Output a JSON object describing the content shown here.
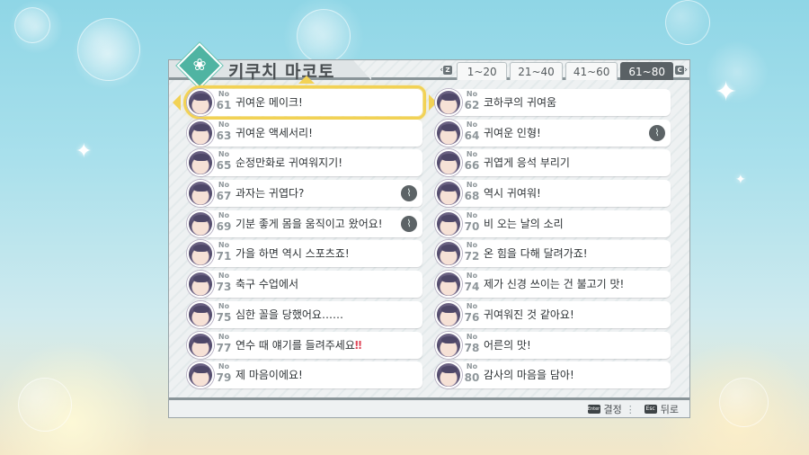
{
  "window": {
    "title": "키쿠치 마코토"
  },
  "tabs": [
    {
      "label": "1~20",
      "active": false
    },
    {
      "label": "21~40",
      "active": false
    },
    {
      "label": "41~60",
      "active": false
    },
    {
      "label": "61~80",
      "active": true
    }
  ],
  "tab_nav": {
    "prev_key": "Z",
    "next_key": "C"
  },
  "no_prefix": "No",
  "items": [
    {
      "no": "61",
      "label": "귀여운 메이크!",
      "selected": true
    },
    {
      "no": "62",
      "label": "코하쿠의 귀여움"
    },
    {
      "no": "63",
      "label": "귀여운 액세서리!"
    },
    {
      "no": "64",
      "label": "귀여운 인형!",
      "clip": true
    },
    {
      "no": "65",
      "label": "순정만화로 귀여워지기!"
    },
    {
      "no": "66",
      "label": "귀엽게 응석 부리기"
    },
    {
      "no": "67",
      "label": "과자는 귀엽다?",
      "clip": true
    },
    {
      "no": "68",
      "label": "역시 귀여워!"
    },
    {
      "no": "69",
      "label": "기분 좋게 몸을 움직이고 왔어요!",
      "clip": true
    },
    {
      "no": "70",
      "label": "비 오는 날의 소리"
    },
    {
      "no": "71",
      "label": "가을 하면 역시 스포츠죠!"
    },
    {
      "no": "72",
      "label": "온 힘을 다해 달려가죠!"
    },
    {
      "no": "73",
      "label": "축구 수업에서"
    },
    {
      "no": "74",
      "label": "제가 신경 쓰이는 건 불고기 맛!"
    },
    {
      "no": "75",
      "label": "심한 꼴을 당했어요……"
    },
    {
      "no": "76",
      "label": "귀여워진 것 같아요!"
    },
    {
      "no": "77",
      "label": "연수 때 얘기를 들려주세요",
      "suffix": "‼"
    },
    {
      "no": "78",
      "label": "어른의 맛!"
    },
    {
      "no": "79",
      "label": "제 마음이에요!"
    },
    {
      "no": "80",
      "label": "감사의 마음을 담아!"
    }
  ],
  "footer": {
    "confirm_key": "Enter",
    "confirm_label": "결정",
    "back_key": "Esc",
    "back_label": "뒤로"
  },
  "colors": {
    "accent": "#4fb4a2",
    "selection": "#f2d255",
    "active_tab": "#5a6165"
  }
}
